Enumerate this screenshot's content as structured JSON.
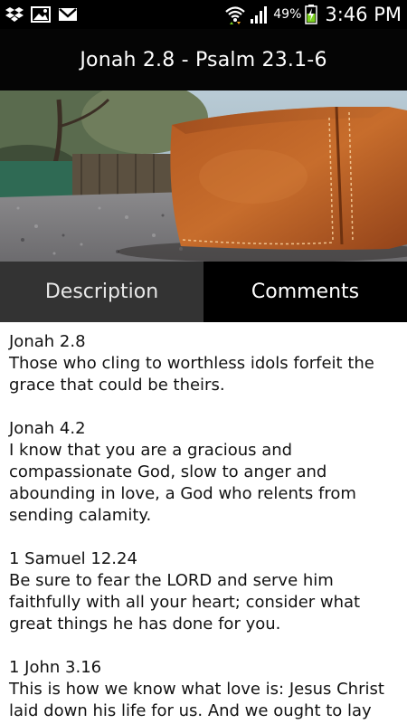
{
  "status_bar": {
    "battery_percent": "49%",
    "time": "3:46 PM",
    "left_icons": [
      "dropbox-icon",
      "image-icon",
      "gmail-icon"
    ],
    "right_icons": [
      "wifi-icon",
      "signal-icon",
      "battery-charging-icon"
    ]
  },
  "header": {
    "title": "Jonah 2.8 - Psalm 23.1-6"
  },
  "hero": {
    "subject": "leather-bible-photo"
  },
  "tabs": [
    {
      "label": "Description",
      "selected": true
    },
    {
      "label": "Comments",
      "selected": false
    }
  ],
  "verses": [
    {
      "ref": "Jonah 2.8",
      "text": "Those who cling to worthless idols forfeit the grace that could be theirs."
    },
    {
      "ref": "Jonah 4.2",
      "text": "I know that you are a gracious and compassionate God, slow to anger and abounding in love, a God who relents from sending calamity."
    },
    {
      "ref": "1 Samuel 12.24",
      "text": "Be sure to fear the LORD and serve him faithfully with all your heart; consider what great things he has done for you."
    },
    {
      "ref": "1 John 3.16",
      "text": "This is how we know what love is: Jesus Christ laid down his life for us. And we ought to lay down our lives for our brothers."
    }
  ],
  "colors": {
    "status_bar_bg": "#000000",
    "action_bar_bg": "#050505",
    "tab_active_bg": "#333333",
    "tab_inactive_bg": "#000000",
    "content_bg": "#ffffff",
    "text": "#121212",
    "battery_green": "#7bd21e"
  }
}
